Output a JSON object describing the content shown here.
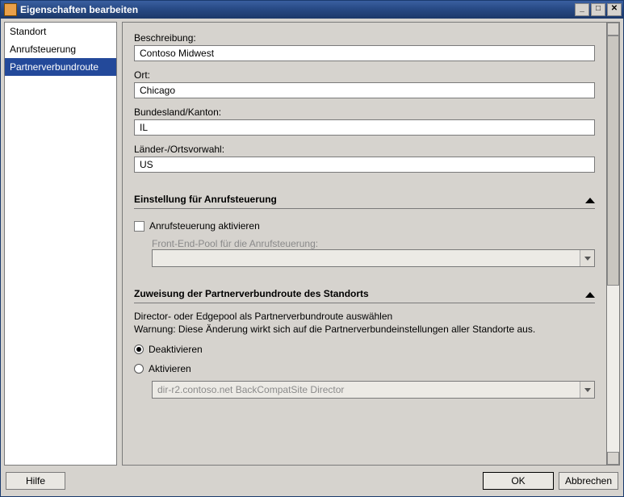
{
  "window": {
    "title": "Eigenschaften bearbeiten"
  },
  "sidebar": {
    "items": [
      {
        "label": "Standort",
        "selected": false
      },
      {
        "label": "Anrufsteuerung",
        "selected": false
      },
      {
        "label": "Partnerverbundroute",
        "selected": true
      }
    ]
  },
  "fields": {
    "description_label": "Beschreibung:",
    "description_value": "Contoso Midwest",
    "city_label": "Ort:",
    "city_value": "Chicago",
    "state_label": "Bundesland/Kanton:",
    "state_value": "IL",
    "country_label": "Länder-/Ortsvorwahl:",
    "country_value": "US"
  },
  "cac": {
    "section_title": "Einstellung für Anrufsteuerung",
    "checkbox_label": "Anrufsteuerung aktivieren",
    "checkbox_checked": false,
    "pool_label": "Front-End-Pool für die Anrufsteuerung:",
    "pool_value": ""
  },
  "fed_route": {
    "section_title": "Zuweisung der Partnerverbundroute des Standorts",
    "desc_line1": "Director- oder Edgepool als Partnerverbundroute auswählen",
    "desc_line2": "Warnung: Diese Änderung wirkt sich auf die Partnerverbundeinstellungen aller Standorte aus.",
    "radio_disable": "Deaktivieren",
    "radio_enable": "Aktivieren",
    "radio_selected": "disable",
    "combo_value": "dir-r2.contoso.net   BackCompatSite   Director"
  },
  "buttons": {
    "help": "Hilfe",
    "ok": "OK",
    "cancel": "Abbrechen"
  }
}
